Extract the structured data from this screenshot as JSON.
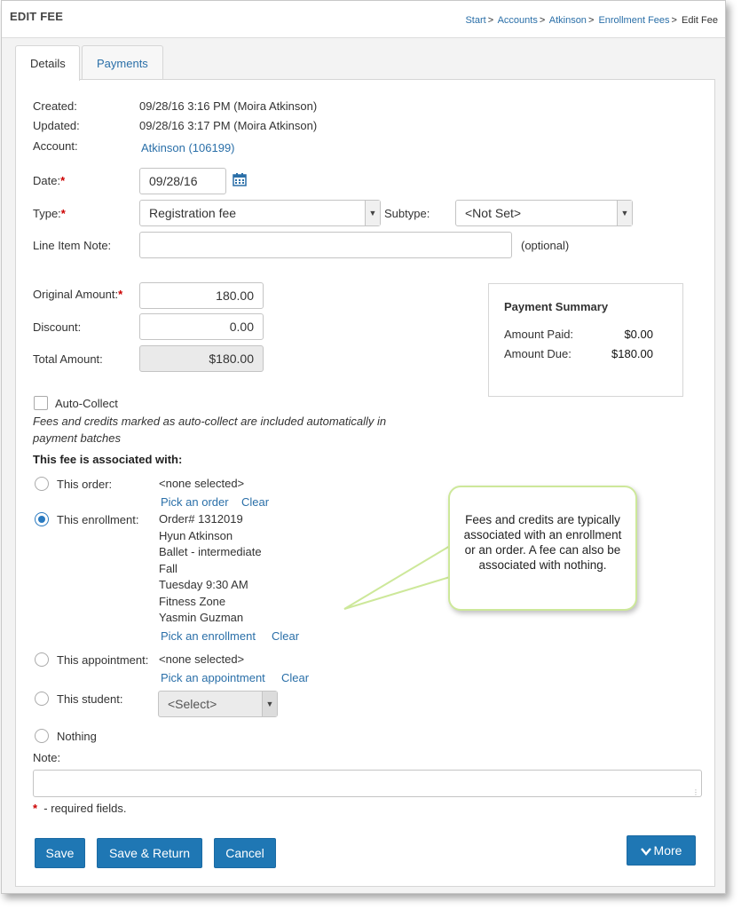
{
  "header": {
    "title": "EDIT FEE",
    "breadcrumb": [
      "Start",
      "Accounts",
      "Atkinson",
      "Enrollment Fees",
      "Edit Fee"
    ],
    "separator": ">"
  },
  "tabs": [
    "Details",
    "Payments"
  ],
  "details": {
    "created_label": "Created:",
    "created_value": "09/28/16 3:16 PM (Moira Atkinson)",
    "updated_label": "Updated:",
    "updated_value": "09/28/16 3:17 PM (Moira Atkinson)",
    "account_label": "Account:",
    "account_value": "Atkinson (106199)"
  },
  "form": {
    "date_label": "Date:",
    "date_value": "09/28/16",
    "type_label": "Type:",
    "type_value": "Registration fee",
    "subtype_label": "Subtype:",
    "subtype_value": "<Not Set>",
    "line_item_label": "Line Item Note:",
    "line_item_value": "",
    "optional_text": "(optional)",
    "required_mark": "*",
    "original_amount_label": "Original Amount:",
    "original_amount_value": "180.00",
    "discount_label": "Discount:",
    "discount_value": "0.00",
    "total_amount_label": "Total Amount:",
    "total_amount_value": "$180.00"
  },
  "payment_summary": {
    "title": "Payment Summary",
    "amount_paid_label": "Amount Paid:",
    "amount_paid_value": "$0.00",
    "amount_due_label": "Amount Due:",
    "amount_due_value": "$180.00"
  },
  "auto_collect": {
    "label": "Auto-Collect",
    "checked": false,
    "help_line1": "Fees and credits marked as auto-collect are included automatically in",
    "help_line2": "payment batches"
  },
  "association": {
    "heading": "This fee is associated with:",
    "order_label": "This order:",
    "order_value": "<none selected>",
    "pick_order": "Pick an order",
    "enrollment_label": "This enrollment:",
    "enrollment_lines": [
      "Order# 1312019",
      "Hyun Atkinson",
      "Ballet - intermediate",
      "Fall",
      "Tuesday 9:30 AM",
      "Fitness Zone",
      "Yasmin Guzman"
    ],
    "pick_enrollment": "Pick an enrollment",
    "appointment_label": "This appointment:",
    "appointment_value": "<none selected>",
    "pick_appointment": "Pick an appointment",
    "student_label": "This student:",
    "student_value": "<Select>",
    "nothing_label": "Nothing",
    "clear_label": "Clear",
    "selected": "enrollment"
  },
  "note": {
    "label": "Note:",
    "value": ""
  },
  "required_note": "- required fields.",
  "buttons": {
    "save": "Save",
    "save_return": "Save & Return",
    "cancel": "Cancel",
    "more": "More"
  },
  "callout": {
    "text": "Fees and credits are typically associated with an enrollment or an order. A fee can also be associated with nothing.",
    "border_color": "#cde89a"
  },
  "colors": {
    "accent": "#1f77b4",
    "link": "#2a6fa8",
    "required": "#cc0000"
  }
}
